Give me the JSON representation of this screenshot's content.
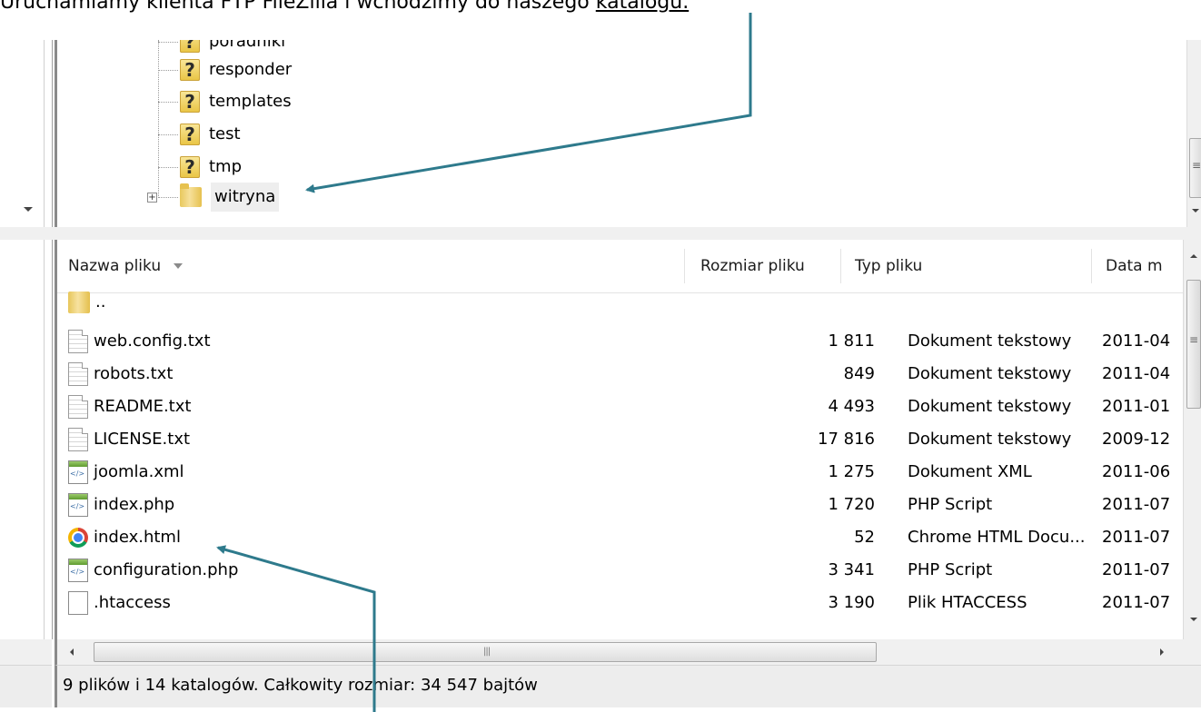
{
  "caption": {
    "text": "Uruchamiamy klienta FTP FileZilla i wchodzimy do naszego ",
    "link": "katalogu."
  },
  "tree": {
    "items": [
      {
        "label": "poradniki",
        "icon": "question-folder-icon"
      },
      {
        "label": "responder",
        "icon": "question-folder-icon"
      },
      {
        "label": "templates",
        "icon": "question-folder-icon"
      },
      {
        "label": "test",
        "icon": "question-folder-icon"
      },
      {
        "label": "tmp",
        "icon": "question-folder-icon"
      },
      {
        "label": "witryna",
        "icon": "folder-icon",
        "expander": "+"
      }
    ]
  },
  "list": {
    "headers": {
      "name": "Nazwa pliku",
      "size": "Rozmiar pliku",
      "type": "Typ pliku",
      "date": "Data m"
    },
    "rows": [
      {
        "name": "..",
        "size": "",
        "type": "",
        "date": "",
        "icon": "folder"
      },
      {
        "name": "web.config.txt",
        "size": "1 811",
        "type": "Dokument tekstowy",
        "date": "2011-04",
        "icon": "txt"
      },
      {
        "name": "robots.txt",
        "size": "849",
        "type": "Dokument tekstowy",
        "date": "2011-04",
        "icon": "txt"
      },
      {
        "name": "README.txt",
        "size": "4 493",
        "type": "Dokument tekstowy",
        "date": "2011-01",
        "icon": "txt"
      },
      {
        "name": "LICENSE.txt",
        "size": "17 816",
        "type": "Dokument tekstowy",
        "date": "2009-12",
        "icon": "txt"
      },
      {
        "name": "joomla.xml",
        "size": "1 275",
        "type": "Dokument XML",
        "date": "2011-06",
        "icon": "code"
      },
      {
        "name": "index.php",
        "size": "1 720",
        "type": "PHP Script",
        "date": "2011-07",
        "icon": "code"
      },
      {
        "name": "index.html",
        "size": "52",
        "type": "Chrome HTML Docu...",
        "date": "2011-07",
        "icon": "chrome"
      },
      {
        "name": "configuration.php",
        "size": "3 341",
        "type": "PHP Script",
        "date": "2011-07",
        "icon": "code"
      },
      {
        "name": ".htaccess",
        "size": "3 190",
        "type": "Plik HTACCESS",
        "date": "2011-07",
        "icon": "plain"
      }
    ]
  },
  "status": {
    "text": "9 plików i 14 katalogów. Całkowity rozmiar: 34 547 bajtów"
  },
  "colors": {
    "arrow": "#2e7a8c",
    "statusbar": "#ededed"
  }
}
